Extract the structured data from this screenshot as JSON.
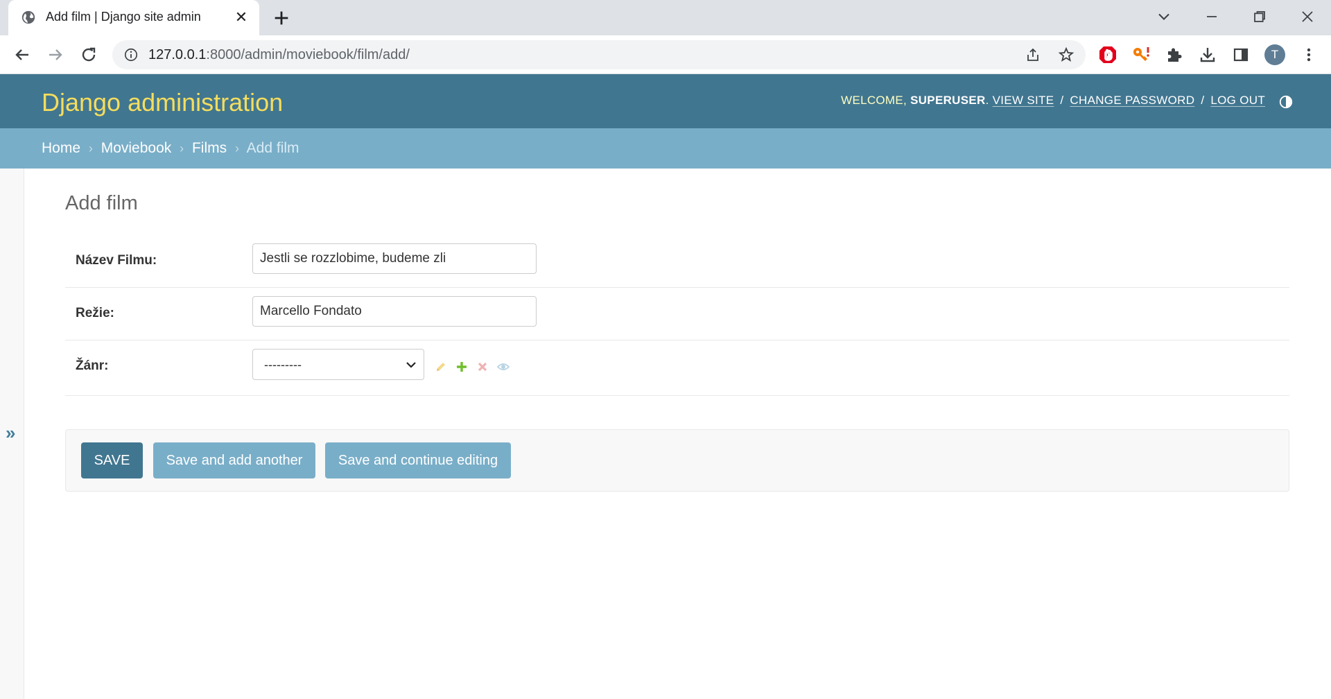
{
  "browser": {
    "tab_title": "Add film | Django site admin",
    "url_host": "127.0.0.1",
    "url_rest": ":8000/admin/moviebook/film/add/",
    "profile_initial": "T"
  },
  "header": {
    "branding": "Django administration",
    "welcome": "Welcome,",
    "username": "superuser",
    "view_site": "View site",
    "change_password": "Change password",
    "log_out": "Log out",
    "separator": "/"
  },
  "breadcrumbs": {
    "items": [
      "Home",
      "Moviebook",
      "Films"
    ],
    "current": "Add film",
    "arrow": "›"
  },
  "sidebar": {
    "toggle_glyph": "»"
  },
  "main": {
    "title": "Add film",
    "fields": [
      {
        "label": "Název Filmu:",
        "value": "Jestli se rozzlobime, budeme zli"
      },
      {
        "label": "Režie:",
        "value": "Marcello Fondato"
      },
      {
        "label": "Žánr:",
        "value": "---------"
      }
    ],
    "buttons": {
      "save": "Save",
      "save_add_another": "Save and add another",
      "save_continue": "Save and continue editing"
    }
  },
  "colors": {
    "header_bg": "#417690",
    "breadcrumbs_bg": "#79aec8",
    "branding": "#f5dd5d",
    "button_primary": "#417690",
    "button_secondary": "#79aec8"
  }
}
